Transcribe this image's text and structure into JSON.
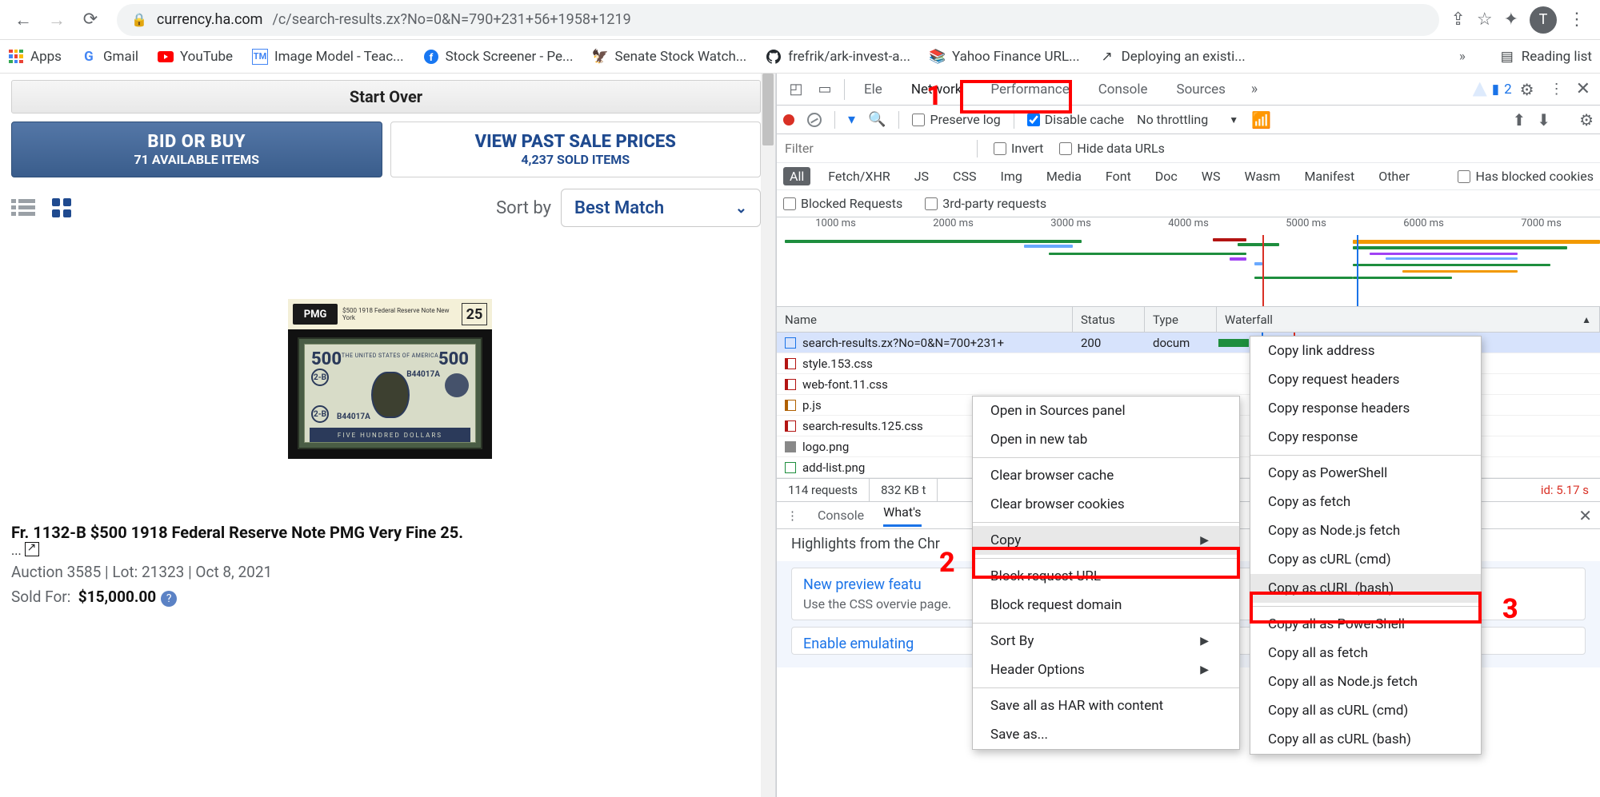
{
  "browser": {
    "url_host": "currency.ha.com",
    "url_path": "/c/search-results.zx?No=0&N=790+231+56+1958+1219",
    "avatar_letter": "T"
  },
  "bookmarks": {
    "items": [
      {
        "label": "Apps"
      },
      {
        "label": "Gmail"
      },
      {
        "label": "YouTube"
      },
      {
        "label": "Image Model - Teac..."
      },
      {
        "label": "Stock Screener - Pe..."
      },
      {
        "label": "Senate Stock Watch..."
      },
      {
        "label": "frefrik/ark-invest-a..."
      },
      {
        "label": "Yahoo Finance URL..."
      },
      {
        "label": "Deploying an existi..."
      }
    ],
    "reading_list": "Reading list"
  },
  "page": {
    "start_over": "Start Over",
    "tabs": {
      "bid_l1": "BID OR BUY",
      "bid_l2": "71 AVAILABLE ITEMS",
      "past_l1": "VIEW PAST SALE PRICES",
      "past_l2": "4,237 SOLD ITEMS"
    },
    "sort_label": "Sort by",
    "sort_value": "Best Match",
    "item": {
      "pmg_logo": "PMG",
      "pmg_grade": "25",
      "pmg_text": "$500 1918  Federal Reserve Note New York",
      "note_text": "THE UNITED STATES OF AMERICA",
      "serial": "B44017A",
      "denom_word": "FIVE HUNDRED DOLLARS",
      "fed": "2-B",
      "title": "Fr. 1132-B $500 1918 Federal Reserve Note PMG Very Fine 25.",
      "ellipsis": "...",
      "meta": "Auction 3585 | Lot: 21323 | Oct 8, 2021",
      "sold_label": "Sold For:",
      "price": "$15,000.00"
    }
  },
  "devtools": {
    "tabs": [
      "Ele",
      "Network",
      "Performance",
      "Console",
      "Sources"
    ],
    "issues_count": "2",
    "toolbar2": {
      "preserve": "Preserve log",
      "disable_cache": "Disable cache",
      "throttle": "No throttling"
    },
    "filter_placeholder": "Filter",
    "invert": "Invert",
    "hide_urls": "Hide data URLs",
    "types": [
      "All",
      "Fetch/XHR",
      "JS",
      "CSS",
      "Img",
      "Media",
      "Font",
      "Doc",
      "WS",
      "Wasm",
      "Manifest",
      "Other"
    ],
    "has_blocked": "Has blocked cookies",
    "blocked_req": "Blocked Requests",
    "third_party": "3rd-party requests",
    "timeline_ticks": [
      "1000 ms",
      "2000 ms",
      "3000 ms",
      "4000 ms",
      "5000 ms",
      "6000 ms",
      "7000 ms"
    ],
    "grid_headers": {
      "name": "Name",
      "status": "Status",
      "type": "Type",
      "wf": "Waterfall"
    },
    "rows": [
      {
        "name": "search-results.zx?No=0&N=700+231+",
        "status": "200",
        "type": "docum",
        "kind": "doc"
      },
      {
        "name": "style.153.css",
        "status": "",
        "type": "",
        "kind": "css"
      },
      {
        "name": "web-font.11.css",
        "status": "",
        "type": "",
        "kind": "css"
      },
      {
        "name": "p.js",
        "status": "",
        "type": "",
        "kind": "js"
      },
      {
        "name": "search-results.125.css",
        "status": "",
        "type": "",
        "kind": "css"
      },
      {
        "name": "logo.png",
        "status": "",
        "type": "",
        "kind": "img"
      },
      {
        "name": "add-list.png",
        "status": "",
        "type": "",
        "kind": "img"
      }
    ],
    "status": {
      "requests": "114 requests",
      "kb": "832 KB t",
      "load": "id: 5.17 s"
    },
    "drawer": {
      "tabs": [
        "Console",
        "What's"
      ],
      "highlights": "Highlights from the Chr"
    },
    "wn": {
      "links": [
        "New preview featu",
        "Enable emulating"
      ],
      "desc": "Use the CSS overvie page."
    },
    "ctx1": [
      "Open in Sources panel",
      "Open in new tab",
      "-",
      "Clear browser cache",
      "Clear browser cookies",
      "-",
      "Copy",
      "-",
      "Block request URL",
      "Block request domain",
      "-",
      "Sort By",
      "Header Options",
      "-",
      "Save all as HAR with content",
      "Save as..."
    ],
    "ctx2": [
      "Copy link address",
      "Copy request headers",
      "Copy response headers",
      "Copy response",
      "-",
      "Copy as PowerShell",
      "Copy as fetch",
      "Copy as Node.js fetch",
      "Copy as cURL (cmd)",
      "Copy as cURL (bash)",
      "-",
      "Copy all as PowerShell",
      "Copy all as fetch",
      "Copy all as Node.js fetch",
      "Copy all as cURL (cmd)",
      "Copy all as cURL (bash)"
    ]
  },
  "annotations": {
    "n1": "1",
    "n2": "2",
    "n3": "3"
  }
}
